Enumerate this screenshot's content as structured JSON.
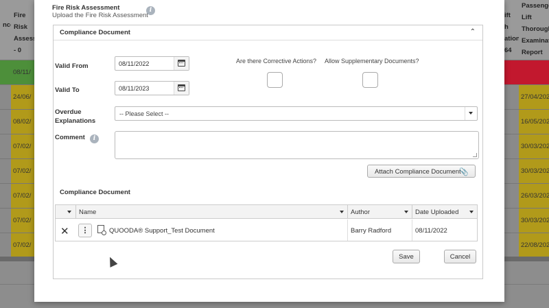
{
  "background": {
    "headers": {
      "left_col": "nce",
      "fire_risk": "Fire Risk\nAssessm\n- 0",
      "lift_partial": "ift\nh\nation\n64",
      "passenger_lift": "Passenge\nLift\nThorough\nExaminati\nReport - 6"
    },
    "left_cells": [
      "08/11/",
      "24/06/",
      "08/02/",
      "07/02/",
      "07/02/",
      "07/02/",
      "07/02/",
      "07/02/"
    ],
    "right_cells": [
      "",
      "27/04/202",
      "16/05/202",
      "30/03/202",
      "30/03/202",
      "26/03/202",
      "30/03/202",
      "22/08/202"
    ]
  },
  "modal": {
    "title": "Fire Risk Assessment",
    "subtitle": "Upload the Fire Risk Assessment",
    "panel_title": "Compliance Document",
    "valid_from_label": "Valid From",
    "valid_from_value": "08/11/2022",
    "valid_to_label": "Valid To",
    "valid_to_value": "08/11/2023",
    "corrective_label": "Are there Corrective Actions?",
    "supplementary_label": "Allow Supplementary Documents?",
    "overdue_label": "Overdue Explanations",
    "overdue_value": "-- Please Select --",
    "comment_label": "Comment",
    "attach_label": "Attach Compliance Document",
    "doc_section_title": "Compliance Document",
    "table": {
      "columns": [
        "Name",
        "Author",
        "Date Uploaded"
      ],
      "rows": [
        {
          "name": "QUOODA® Support_Test Document",
          "author": "Barry Radford",
          "date": "08/11/2022"
        }
      ]
    },
    "save_label": "Save",
    "cancel_label": "Cancel"
  }
}
